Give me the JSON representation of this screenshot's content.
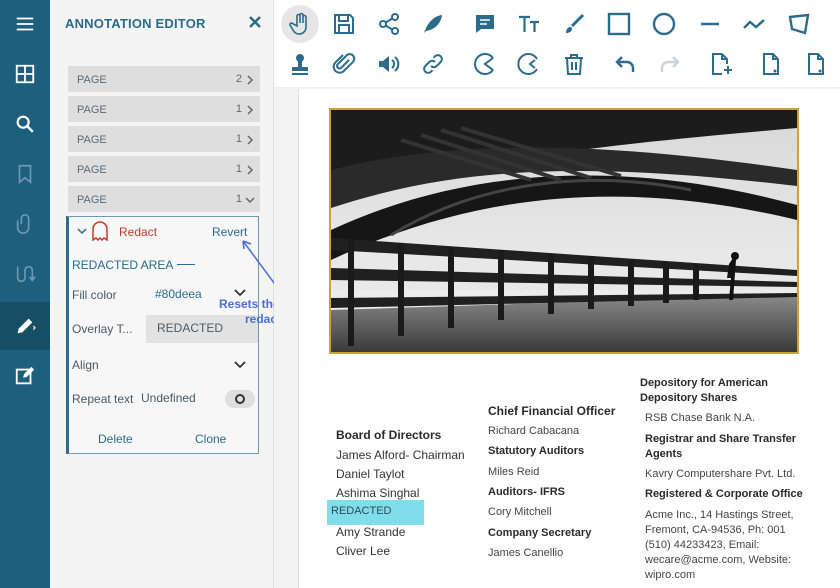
{
  "panel": {
    "title": "ANNOTATION EDITOR",
    "pages": [
      {
        "label": "PAGE",
        "count": "2"
      },
      {
        "label": "PAGE",
        "count": "1"
      },
      {
        "label": "PAGE",
        "count": "1"
      },
      {
        "label": "PAGE",
        "count": "1"
      },
      {
        "label": "PAGE",
        "count": "1"
      }
    ],
    "editor": {
      "type_label": "Redact",
      "revert_label": "Revert",
      "section_title": "REDACTED AREA",
      "fill_label": "Fill color",
      "fill_value": "#80deea",
      "overlay_label": "Overlay T...",
      "overlay_value": "REDACTED",
      "align_label": "Align",
      "repeat_label": "Repeat text",
      "repeat_value": "Undefined",
      "delete_label": "Delete",
      "clone_label": "Clone"
    },
    "callout": "Resets the applied redaction"
  },
  "colors": {
    "rail": "#1f5f7e",
    "accent": "#2b6b8c",
    "redact_fill": "#80deea",
    "frame": "#c9a338",
    "callout": "#4a6fd8"
  },
  "document": {
    "board": {
      "heading": "Board of Directors",
      "members": [
        "James Alford- Chairman",
        "Daniel Taylot",
        "Ashima Singhal",
        "Amy Strande",
        "Cliver Lee"
      ],
      "redacted_text": "REDACTED"
    },
    "middle": {
      "cfo_heading": "Chief Financial Officer",
      "cfo_name": "Richard Cabacana",
      "auditors_heading": "Statutory Auditors",
      "auditors_name": "Miles Reid",
      "ifrs_heading": "Auditors- IFRS",
      "ifrs_name": "Cory Mitchell",
      "secretary_heading": "Company Secretary",
      "secretary_name": "James Canellio"
    },
    "right": {
      "depository_heading": "Depository for American Depository Shares",
      "depository_name": "RSB Chase Bank N.A.",
      "registrar_heading": "Registrar and Share Transfer Agents",
      "registrar_name": "Kavry Computershare Pvt. Ltd.",
      "office_heading": "Registered & Corporate Office",
      "office_address": [
        "Acme Inc., 14 Hastings Street,",
        "Fremont, CA-94536, Ph: 001",
        "(510) 44233423, Email:",
        "wecare@acme.com, Website:",
        "wipro.com"
      ]
    }
  }
}
